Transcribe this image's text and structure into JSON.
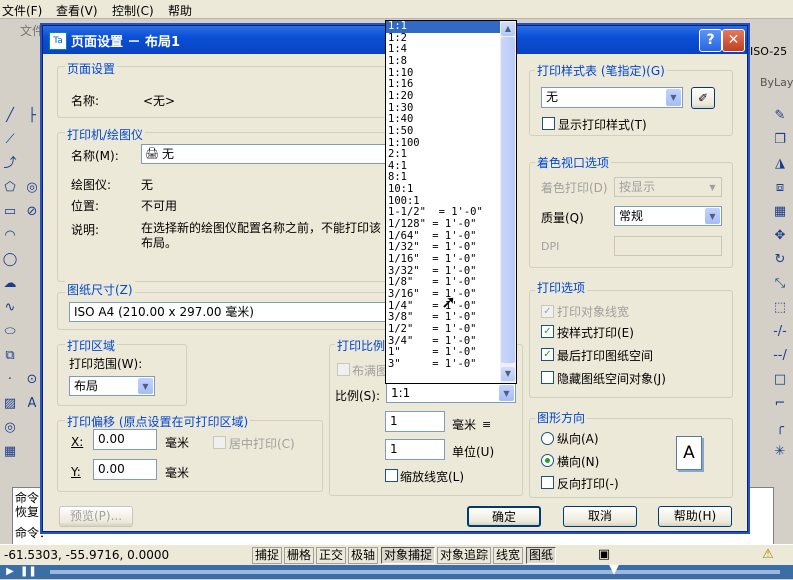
{
  "menu": [
    "文件(F)",
    "查看(V)",
    "控制(C)",
    "帮助"
  ],
  "bg": {
    "tab_file": "文件",
    "style_box": "ISO-25",
    "bylayer": "ByLay",
    "command_lines": [
      "命令：",
      "恢复",
      "命令："
    ]
  },
  "status": {
    "coords": "-61.5303, -55.9716, 0.0000",
    "buttons": [
      "捕捉",
      "栅格",
      "正交",
      "极轴",
      "对象捕捉",
      "对象追踪",
      "线宽",
      "图纸"
    ]
  },
  "dialog": {
    "title": "页面设置 － 布局1",
    "page_setup": {
      "group": "页面设置",
      "name_label": "名称:",
      "name_value": "<无>"
    },
    "printer": {
      "group": "打印机/绘图仪",
      "name_label": "名称(M):",
      "name_value": "无",
      "plotter_label": "绘图仪:",
      "plotter_value": "无",
      "location_label": "位置:",
      "location_value": "不可用",
      "desc_label": "说明:",
      "desc_value": "在选择新的绘图仪配置名称之前，不能打印该布局。"
    },
    "paper": {
      "group": "图纸尺寸(Z)",
      "value": "ISO A4 (210.00 x 297.00 毫米)"
    },
    "area": {
      "group": "打印区域",
      "range_label": "打印范围(W):",
      "range_value": "布局"
    },
    "offset": {
      "group": "打印偏移 (原点设置在可打印区域)",
      "x_label": "X:",
      "x_value": "0.00",
      "x_unit": "毫米",
      "y_label": "Y:",
      "y_value": "0.00",
      "y_unit": "毫米",
      "center": "居中打印(C)"
    },
    "scale": {
      "group": "打印比例",
      "fit": "布满图",
      "ratio_label": "比例(S):",
      "ratio_value": "1:1",
      "val1": "1",
      "unit1": "毫米",
      "val2": "1",
      "unit2": "单位(U)",
      "lineweight": "缩放线宽(L)",
      "list": [
        "1:1",
        "1:2",
        "1:4",
        "1:8",
        "1:10",
        "1:16",
        "1:20",
        "1:30",
        "1:40",
        "1:50",
        "1:100",
        "2:1",
        "4:1",
        "8:1",
        "10:1",
        "100:1",
        "1-1/2\"  = 1'-0\"",
        "1/128\" = 1'-0\"",
        "1/64\"  = 1'-0\"",
        "1/32\"  = 1'-0\"",
        "1/16\"  = 1'-0\"",
        "3/32\"  = 1'-0\"",
        "1/8\"   = 1'-0\"",
        "3/16\"  = 1'-0\"",
        "1/4\"   = 1'-0\"",
        "3/8\"   = 1'-0\"",
        "1/2\"   = 1'-0\"",
        "3/4\"   = 1'-0\"",
        "1\"     = 1'-0\"",
        "3\"     = 1'-0\""
      ]
    },
    "plot_style": {
      "group": "打印样式表 (笔指定)(G)",
      "value": "无",
      "display": "显示打印样式(T)"
    },
    "shaded": {
      "group": "着色视口选项",
      "shade_label": "着色打印(D)",
      "shade_value": "按显示",
      "quality_label": "质量(Q)",
      "quality_value": "常规",
      "dpi_label": "DPI"
    },
    "options": {
      "group": "打印选项",
      "items": [
        "打印对象线宽",
        "按样式打印(E)",
        "最后打印图纸空间",
        "隐藏图纸空间对象(J)"
      ]
    },
    "orientation": {
      "group": "图形方向",
      "portrait": "纵向(A)",
      "landscape": "横向(N)",
      "reverse": "反向打印(-)",
      "icon_letter": "A"
    },
    "buttons": {
      "preview": "预览(P)...",
      "ok": "确定",
      "cancel": "取消",
      "help": "帮助(H)"
    }
  }
}
